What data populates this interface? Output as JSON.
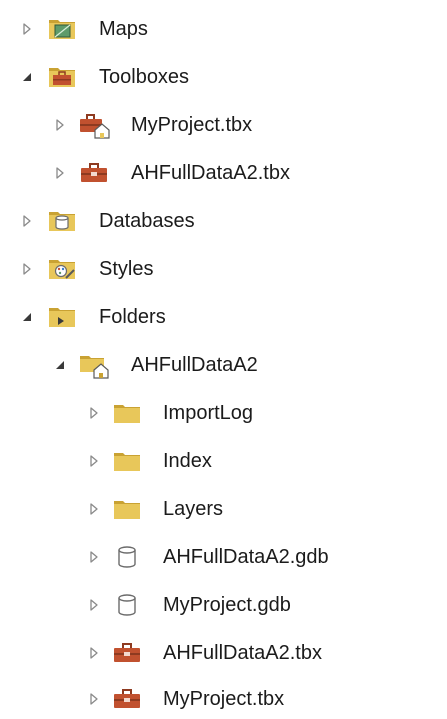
{
  "tree": {
    "items": [
      {
        "label": "Maps",
        "state": "collapsed",
        "icon": "map-icon"
      },
      {
        "label": "Toolboxes",
        "state": "expanded",
        "icon": "toolboxes-folder-icon"
      },
      {
        "label": "MyProject.tbx",
        "state": "collapsed",
        "icon": "toolbox-home-icon"
      },
      {
        "label": "AHFullDataA2.tbx",
        "state": "collapsed",
        "icon": "toolbox-icon"
      },
      {
        "label": "Databases",
        "state": "collapsed",
        "icon": "databases-folder-icon"
      },
      {
        "label": "Styles",
        "state": "collapsed",
        "icon": "styles-folder-icon"
      },
      {
        "label": "Folders",
        "state": "expanded",
        "icon": "folders-folder-icon"
      },
      {
        "label": "AHFullDataA2",
        "state": "expanded",
        "icon": "home-folder-icon"
      },
      {
        "label": "ImportLog",
        "state": "collapsed",
        "icon": "folder-icon"
      },
      {
        "label": "Index",
        "state": "collapsed",
        "icon": "folder-icon"
      },
      {
        "label": "Layers",
        "state": "collapsed",
        "icon": "folder-icon"
      },
      {
        "label": "AHFullDataA2.gdb",
        "state": "collapsed",
        "icon": "geodatabase-icon"
      },
      {
        "label": "MyProject.gdb",
        "state": "collapsed",
        "icon": "geodatabase-icon"
      },
      {
        "label": "AHFullDataA2.tbx",
        "state": "collapsed",
        "icon": "toolbox-icon"
      },
      {
        "label": "MyProject.tbx",
        "state": "collapsed",
        "icon": "toolbox-icon"
      }
    ]
  },
  "colors": {
    "folder_yellow": "#e8c75a",
    "folder_dark": "#c9a233",
    "toolbox_red": "#c1512f",
    "map_green": "#5e9b6a",
    "expander": "#8a8a8a",
    "text": "#1b1b1b"
  }
}
